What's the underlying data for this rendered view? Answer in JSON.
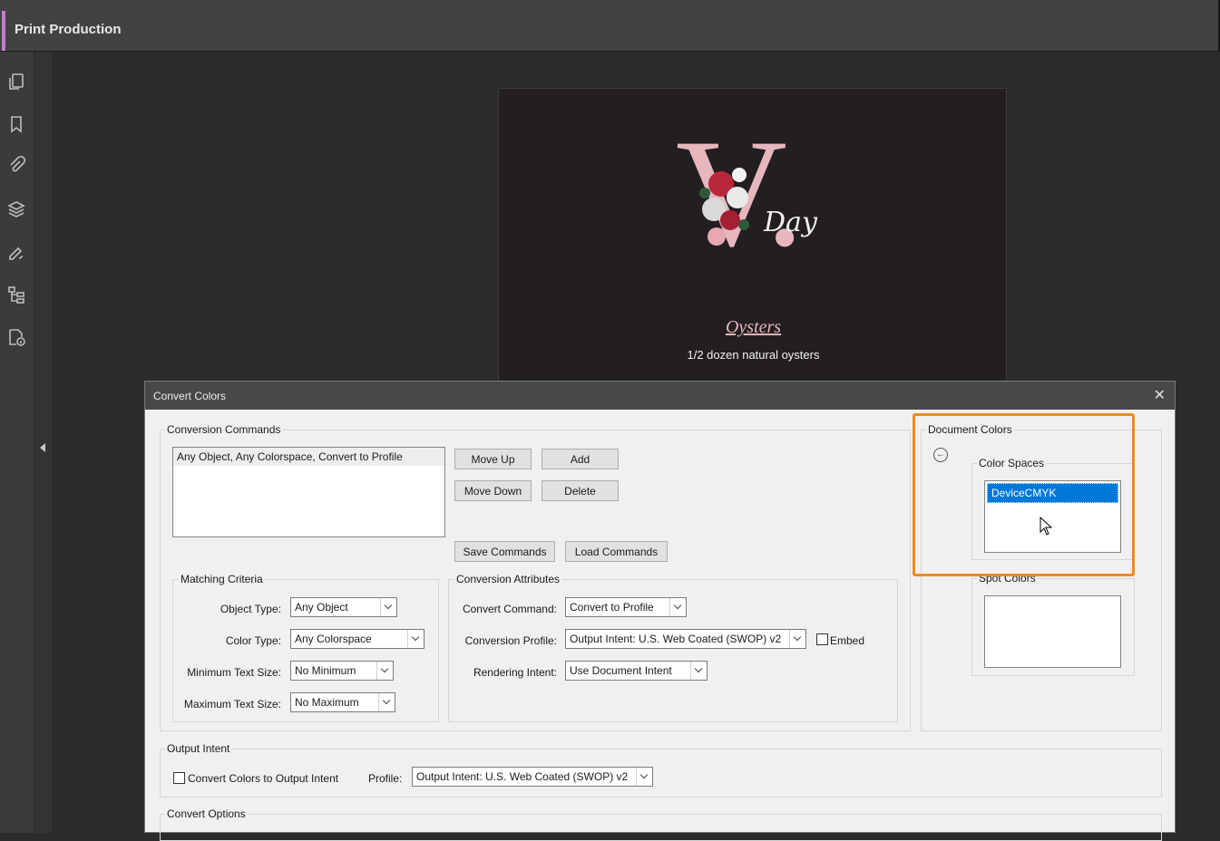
{
  "panel": {
    "title": "Print Production"
  },
  "rail": {
    "icons": [
      "pages-icon",
      "bookmark-icon",
      "attachment-icon",
      "layers-icon",
      "signature-icon",
      "structure-icon",
      "accessibility-icon"
    ]
  },
  "document": {
    "monogram": "V.",
    "script": "Day",
    "item_title": "Oysters",
    "item_desc": "1/2 dozen natural oysters"
  },
  "dialog": {
    "title": "Convert Colors",
    "conversion_commands": {
      "label": "Conversion Commands",
      "items": [
        "Any Object, Any Colorspace, Convert to Profile"
      ],
      "move_up": "Move Up",
      "move_down": "Move Down",
      "add": "Add",
      "delete": "Delete",
      "save": "Save Commands",
      "load": "Load Commands"
    },
    "matching_criteria": {
      "label": "Matching Criteria",
      "object_type_label": "Object Type:",
      "object_type": "Any Object",
      "color_type_label": "Color Type:",
      "color_type": "Any Colorspace",
      "min_text_label": "Minimum Text Size:",
      "min_text": "No Minimum",
      "max_text_label": "Maximum Text Size:",
      "max_text": "No Maximum"
    },
    "conversion_attributes": {
      "label": "Conversion Attributes",
      "command_label": "Convert Command:",
      "command": "Convert to Profile",
      "profile_label": "Conversion Profile:",
      "profile": "Output Intent: U.S. Web Coated (SWOP) v2",
      "embed_label": "Embed",
      "intent_label": "Rendering Intent:",
      "intent": "Use Document Intent"
    },
    "document_colors": {
      "label": "Document Colors",
      "color_spaces_label": "Color Spaces",
      "color_spaces": [
        "DeviceCMYK"
      ],
      "spot_colors_label": "Spot Colors"
    },
    "output_intent": {
      "label": "Output Intent",
      "convert_label": "Convert Colors to Output Intent",
      "profile_label": "Profile:",
      "profile": "Output Intent: U.S. Web Coated (SWOP) v2"
    },
    "convert_options": {
      "label": "Convert Options"
    }
  },
  "colors": {
    "accent": "#c77bd0",
    "highlight": "#f0891e",
    "selection": "#0078d7"
  }
}
